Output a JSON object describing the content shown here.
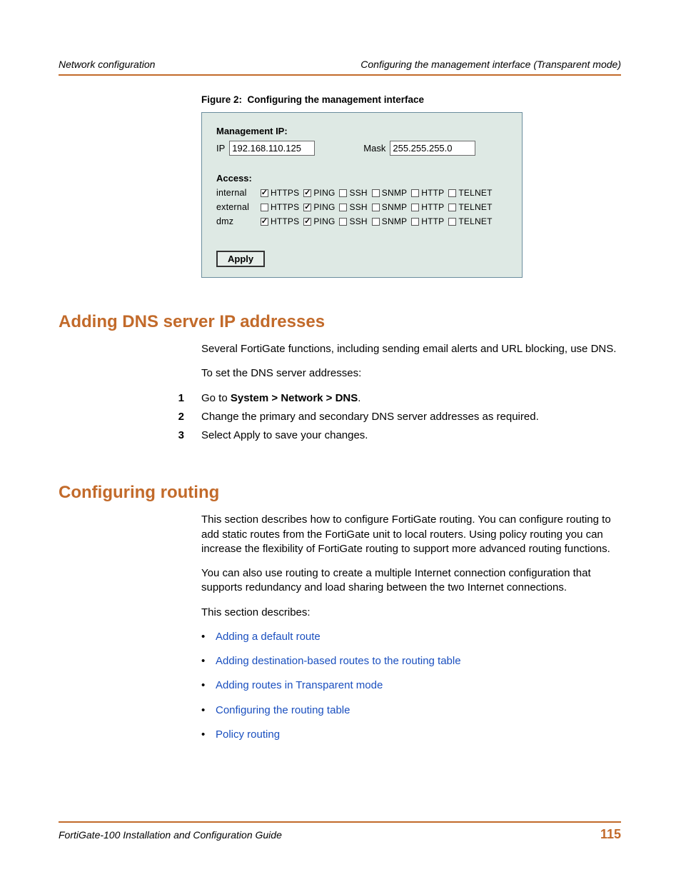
{
  "header": {
    "left": "Network configuration",
    "right": "Configuring the management interface (Transparent mode)"
  },
  "figure": {
    "caption_prefix": "Figure 2:",
    "caption_text": "Configuring the management interface",
    "section_mgmt": "Management IP:",
    "ip_label": "IP",
    "ip_value": "192.168.110.125",
    "mask_label": "Mask",
    "mask_value": "255.255.255.0",
    "section_access": "Access:",
    "protocols": [
      "HTTPS",
      "PING",
      "SSH",
      "SNMP",
      "HTTP",
      "TELNET"
    ],
    "rows": [
      {
        "iface": "internal",
        "checked": [
          true,
          true,
          false,
          false,
          false,
          false
        ]
      },
      {
        "iface": "external",
        "checked": [
          false,
          true,
          false,
          false,
          false,
          false
        ]
      },
      {
        "iface": "dmz",
        "checked": [
          true,
          true,
          false,
          false,
          false,
          false
        ]
      }
    ],
    "apply": "Apply"
  },
  "sec_dns": {
    "heading": "Adding DNS server IP addresses",
    "intro": "Several FortiGate functions, including sending email alerts and URL blocking, use DNS.",
    "lead": "To set the DNS server addresses:",
    "steps": [
      {
        "n": "1",
        "pre": "Go to ",
        "bold": "System > Network > DNS",
        "post": "."
      },
      {
        "n": "2",
        "pre": "Change the primary and secondary DNS server addresses as required.",
        "bold": "",
        "post": ""
      },
      {
        "n": "3",
        "pre": "Select Apply to save your changes.",
        "bold": "",
        "post": ""
      }
    ]
  },
  "sec_routing": {
    "heading": "Configuring routing",
    "p1": "This section describes how to configure FortiGate routing. You can configure routing to add static routes from the FortiGate unit to local routers. Using policy routing you can increase the flexibility of FortiGate routing to support more advanced routing functions.",
    "p2": "You can also use routing to create a multiple Internet connection configuration that supports redundancy and load sharing between the two Internet connections.",
    "p3": "This section describes:",
    "links": [
      "Adding a default route",
      "Adding destination-based routes to the routing table",
      "Adding routes in Transparent mode",
      "Configuring the routing table",
      "Policy routing"
    ]
  },
  "footer": {
    "title": "FortiGate-100 Installation and Configuration Guide",
    "page": "115"
  }
}
